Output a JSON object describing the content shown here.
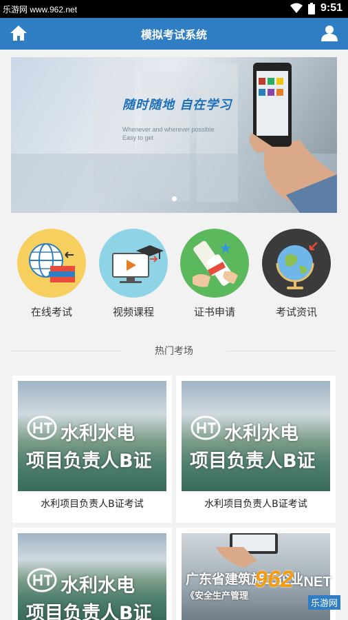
{
  "status_bar": {
    "watermark": "乐游网 www.962.net",
    "time": "9:51",
    "icons": [
      "wifi-icon",
      "battery-icon"
    ]
  },
  "app_bar": {
    "title": "模拟考试系统",
    "left_icon": "home-icon",
    "right_icon": "user-icon"
  },
  "banner": {
    "slogan": "随时随地  自在学习",
    "sub_line_1": "Whenever and wherever possible",
    "sub_line_2": "Easy to get"
  },
  "categories": [
    {
      "label": "在线考试",
      "icon": "globe-books-icon"
    },
    {
      "label": "视频课程",
      "icon": "video-monitor-icon"
    },
    {
      "label": "证书申请",
      "icon": "certificate-icon"
    },
    {
      "label": "考试资讯",
      "icon": "globe-news-icon"
    }
  ],
  "hot_section": {
    "title": "热门考场"
  },
  "cards": [
    {
      "line1": "水利水电",
      "line2": "项目负责人B证",
      "caption": "水利项目负责人B证考试"
    },
    {
      "line1": "水利水电",
      "line2": "项目负责人B证",
      "caption": "水利项目负责人B证考试"
    },
    {
      "line1": "水利水电",
      "line2": "项目负责人B证",
      "caption": ""
    },
    {
      "line1": "广东省建筑施工企业",
      "line2": "《安全生产管理",
      "caption": ""
    }
  ],
  "watermark_badge": {
    "num": "962",
    "net": ".NET",
    "site": "乐游网"
  },
  "colors": {
    "primary": "#2f7ec3",
    "background": "#f2f2f2"
  }
}
